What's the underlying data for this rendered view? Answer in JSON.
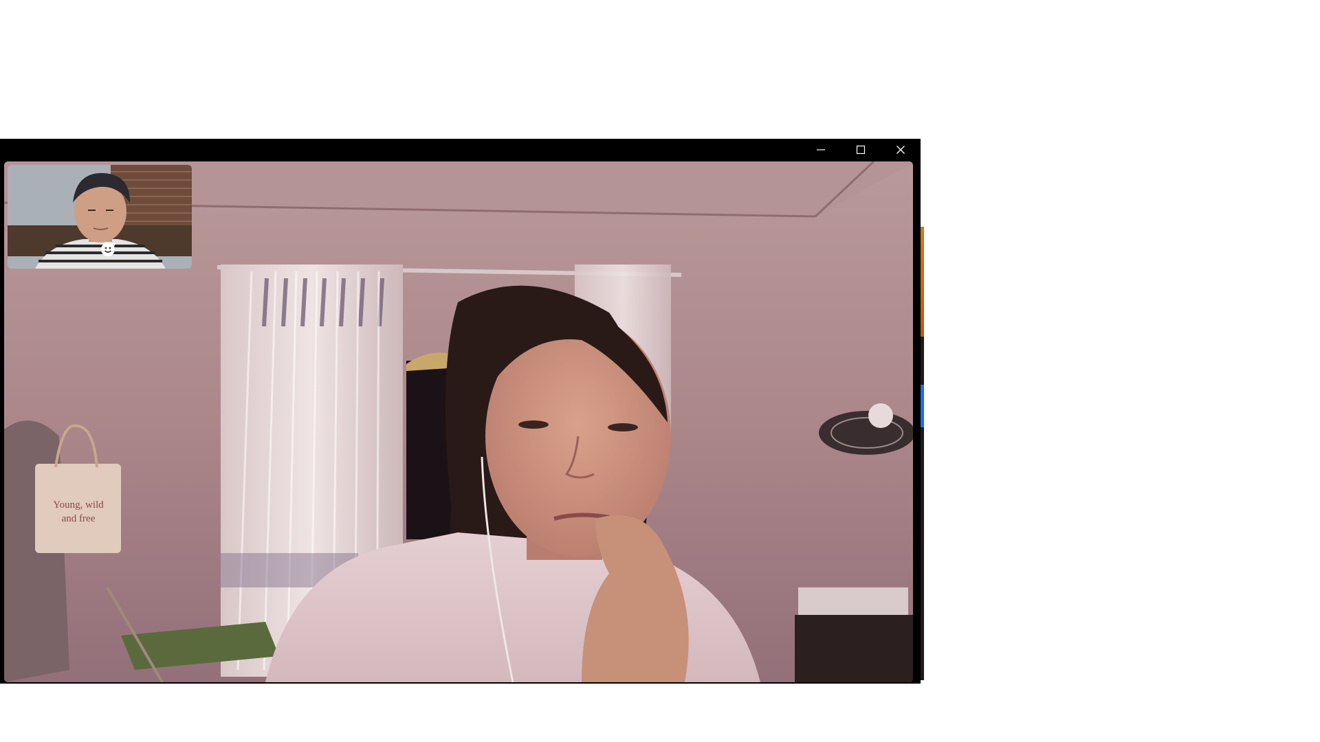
{
  "window": {
    "controls": [
      {
        "name": "minimize",
        "icon": "minimize-icon"
      },
      {
        "name": "maximize",
        "icon": "maximize-icon"
      },
      {
        "name": "close",
        "icon": "close-icon"
      }
    ]
  },
  "remote_video": {
    "tote_bag_text_line1": "Young, wild",
    "tote_bag_text_line2": "and free"
  },
  "self_view": {
    "effects_icon": "face-effects-icon"
  },
  "colors": {
    "titlebar": "#000000",
    "wall": "#a98588",
    "background_window_accent": "#1e6fe0"
  }
}
